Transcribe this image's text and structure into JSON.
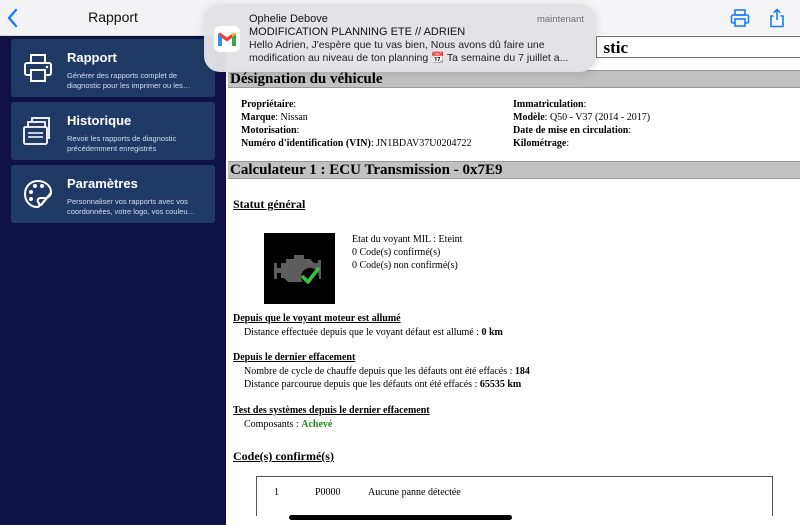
{
  "sidebar": {
    "back_icon": "chevron-left-icon",
    "title": "Rapport",
    "items": [
      {
        "title": "Rapport",
        "description": "Générer des rapports complet de diagnostic pour les imprimer ou les…",
        "icon": "printer-icon"
      },
      {
        "title": "Historique",
        "description": "Revoir les rapports de diagnostic précédemment enregistrés",
        "icon": "documents-icon"
      },
      {
        "title": "Paramètres",
        "description": "Personnaliser vos rapports avec vos coordonnées, votre logo, vos couleu…",
        "icon": "palette-icon"
      }
    ]
  },
  "toolbar": {
    "print_icon": "print-icon",
    "share_icon": "share-icon"
  },
  "report": {
    "title_fragment": "stic",
    "vehicle_section": "Désignation du véhicule",
    "vehicle_left": [
      {
        "label": "Propriétaire",
        "value": ""
      },
      {
        "label": "Marque",
        "value": "Nissan"
      },
      {
        "label": "Motorisation",
        "value": ""
      },
      {
        "label": "Numéro d'identification (VIN)",
        "value": "JN1BDAV37U0204722"
      }
    ],
    "vehicle_right": [
      {
        "label": "Immatriculation",
        "value": ""
      },
      {
        "label": "Modèle",
        "value": "Q50 - V37 (2014 - 2017)"
      },
      {
        "label": "Date de mise en circulation",
        "value": ""
      },
      {
        "label": "Kilométrage",
        "value": ""
      }
    ],
    "ecu_section": "Calculateur 1 : ECU Transmission - 0x7E9",
    "status_heading": "Statut général",
    "status_lines": [
      "Etat du voyant MIL : Eteint",
      "0 Code(s) confirmé(s)",
      "0 Code(s) non confirmé(s)"
    ],
    "mil_heading": "Depuis que le voyant moteur est allumé",
    "mil_line_text": "Distance effectuée depuis que le voyant défaut est allumé : ",
    "mil_line_value": "0 km",
    "clear_heading": "Depuis le dernier effacement",
    "clear_line1_text": "Nombre de cycle de chauffe depuis que les défauts ont été effacés : ",
    "clear_line1_value": "184",
    "clear_line2_text": "Distance parcourue depuis que les défauts ont été effacés : ",
    "clear_line2_value": "65535 km",
    "tests_heading": "Test des systèmes depuis le dernier effacement",
    "tests_line_text": "Composants : ",
    "tests_line_value": "Achevé",
    "tests_value_color": "#1e8a1e",
    "codes_heading": "Code(s) confirmé(s)",
    "codes": [
      {
        "index": "1",
        "code": "P0000",
        "description": "Aucune panne détectée"
      }
    ]
  },
  "notification": {
    "app_icon": "gmail-icon",
    "sender": "Ophelie Debove",
    "time": "maintenant",
    "subject": "MODIFICATION PLANNING ETE // ADRIEN",
    "body": "Hello Adrien, J'espère que tu vas bien, Nous avons dû faire une modification au niveau de ton planning 📆 Ta semaine du 7 juillet a..."
  },
  "colors": {
    "sidebar_bg": "#0f1245",
    "card_bg": "#1f3b65",
    "accent": "#1a7cf5",
    "section_bg": "#c1c1c1"
  }
}
